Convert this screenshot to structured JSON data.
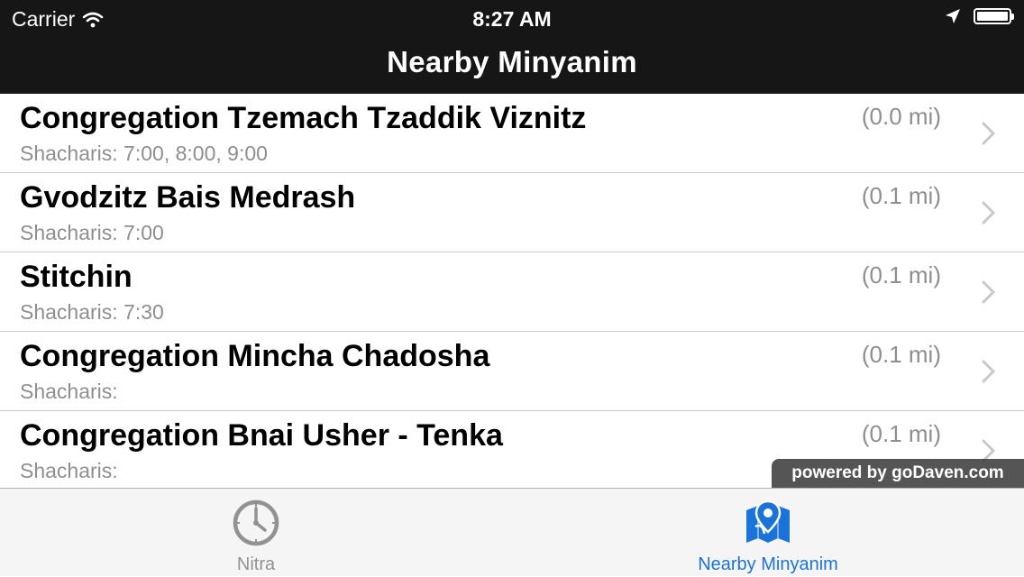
{
  "status_bar": {
    "carrier": "Carrier",
    "time": "8:27 AM"
  },
  "nav": {
    "title": "Nearby Minyanim"
  },
  "rows": [
    {
      "name": "Congregation Tzemach Tzaddik Viznitz",
      "times": "Shacharis: 7:00, 8:00, 9:00",
      "distance": "(0.0 mi)"
    },
    {
      "name": "Gvodzitz Bais Medrash",
      "times": "Shacharis: 7:00",
      "distance": "(0.1 mi)"
    },
    {
      "name": "Stitchin",
      "times": "Shacharis: 7:30",
      "distance": "(0.1 mi)"
    },
    {
      "name": "Congregation Mincha Chadosha",
      "times": "Shacharis:",
      "distance": "(0.1 mi)"
    },
    {
      "name": "Congregation Bnai Usher - Tenka",
      "times": "Shacharis:",
      "distance": "(0.1 mi)"
    }
  ],
  "overlay": {
    "powered_by": "powered by goDaven.com"
  },
  "tabs": [
    {
      "label": "Nitra",
      "icon": "clock-icon",
      "selected": false
    },
    {
      "label": "Nearby Minyanim",
      "icon": "map-pin-icon",
      "selected": true
    }
  ],
  "colors": {
    "nav_bg": "#161616",
    "accent_blue": "#1a73d9",
    "secondary_text": "#8e8e93"
  }
}
